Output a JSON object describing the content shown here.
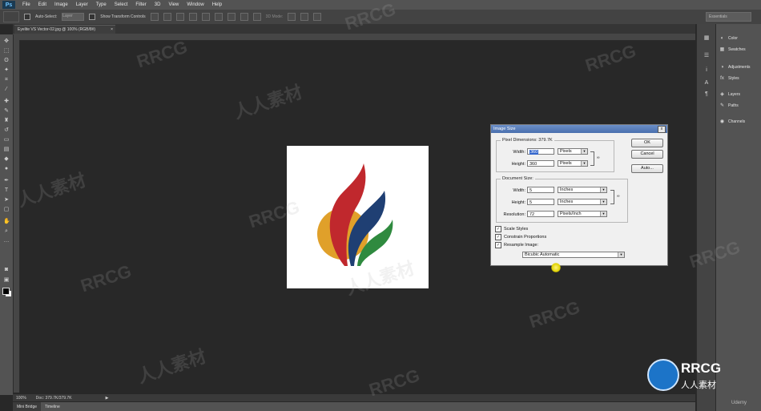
{
  "app": {
    "logo": "Ps",
    "menu": [
      "File",
      "Edit",
      "Image",
      "Layer",
      "Type",
      "Select",
      "Filter",
      "3D",
      "View",
      "Window",
      "Help"
    ]
  },
  "options_bar": {
    "auto_select_label": "Auto-Select:",
    "auto_select_value": "Layer",
    "show_transform_label": "Show Transform Controls",
    "mode_3d_label": "3D Mode:",
    "workspace": "Essentials"
  },
  "document": {
    "tab_title": "Eyelite VS Vector-02.jpg @ 100% (RGB/8#)",
    "tab_close": "×",
    "zoom": "100%",
    "doc_info": "Doc: 379.7K/379.7K"
  },
  "bottom_tabs": [
    "Mini Bridge",
    "Timeline"
  ],
  "panels": {
    "items": [
      {
        "icon": "color-icon",
        "glyph": "◐",
        "label": "Color"
      },
      {
        "icon": "swatches-icon",
        "glyph": "▦",
        "label": "Swatches"
      },
      {
        "icon": "adjustments-icon",
        "glyph": "◑",
        "label": "Adjustments"
      },
      {
        "icon": "styles-icon",
        "glyph": "fx",
        "label": "Styles"
      },
      {
        "icon": "layers-icon",
        "glyph": "◈",
        "label": "Layers"
      },
      {
        "icon": "paths-icon",
        "glyph": "✎",
        "label": "Paths"
      },
      {
        "icon": "channels-icon",
        "glyph": "◉",
        "label": "Channels"
      }
    ]
  },
  "dialog": {
    "title": "Image Size",
    "close_label": "x",
    "pixel_dimensions_label": "Pixel Dimensions: 379.7K",
    "width_label": "Width:",
    "width_px": "360",
    "width_px_unit": "Pixels",
    "height_label": "Height:",
    "height_px": "360",
    "height_px_unit": "Pixels",
    "document_size_label": "Document Size:",
    "doc_width_label": "Width:",
    "doc_width": "5",
    "doc_width_unit": "Inches",
    "doc_height_label": "Height:",
    "doc_height": "5",
    "doc_height_unit": "Inches",
    "resolution_label": "Resolution:",
    "resolution": "72",
    "resolution_unit": "Pixels/Inch",
    "scale_styles": "Scale Styles",
    "constrain_proportions": "Constrain Proportions",
    "resample_image": "Resample Image:",
    "resample_method": "Bicubic Automatic",
    "ok_label": "OK",
    "cancel_label": "Cancel",
    "auto_label": "Auto..."
  },
  "watermark": {
    "brand": "RRCG",
    "sub": "人人素材",
    "udemy": "Udemy"
  },
  "colors": {
    "logo_red": "#c0282d",
    "logo_blue": "#1f3f73",
    "logo_green": "#2f8a3f",
    "logo_orange": "#e0a02a"
  }
}
